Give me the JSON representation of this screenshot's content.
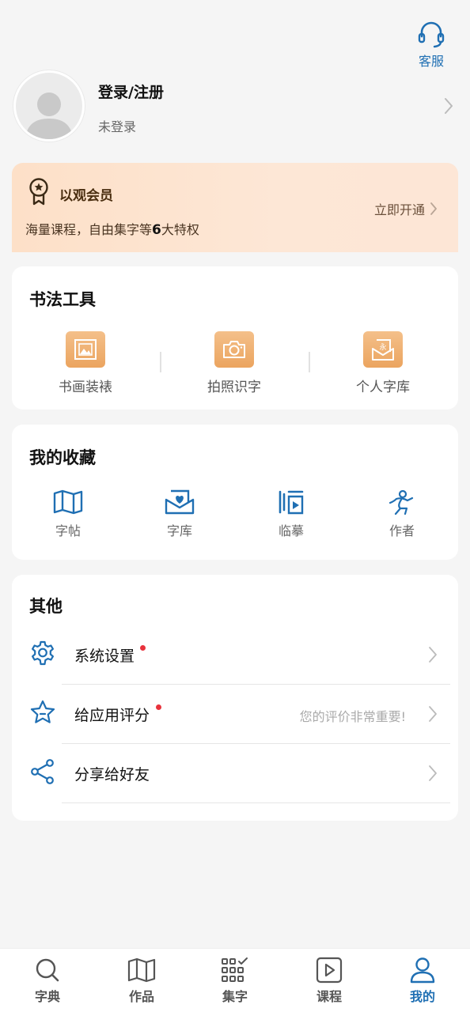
{
  "header": {
    "service_label": "客服"
  },
  "profile": {
    "title": "登录/注册",
    "subtitle": "未登录"
  },
  "vip": {
    "title": "以观会员",
    "desc_prefix": "海量课程，自由集字等",
    "desc_number": "6",
    "desc_suffix": "大特权",
    "cta": "立即开通"
  },
  "tools": {
    "title": "书法工具",
    "items": [
      {
        "label": "书画装裱",
        "icon": "frame-icon"
      },
      {
        "label": "拍照识字",
        "icon": "camera-icon"
      },
      {
        "label": "个人字库",
        "icon": "library-icon"
      }
    ]
  },
  "favorites": {
    "title": "我的收藏",
    "items": [
      {
        "label": "字帖",
        "icon": "map-book-icon"
      },
      {
        "label": "字库",
        "icon": "heart-envelope-icon"
      },
      {
        "label": "临摹",
        "icon": "copy-practice-icon"
      },
      {
        "label": "作者",
        "icon": "author-icon"
      }
    ]
  },
  "other": {
    "title": "其他",
    "items": [
      {
        "label": "系统设置",
        "icon": "gear-icon",
        "hint": "",
        "dot": true
      },
      {
        "label": "给应用评分",
        "icon": "star-icon",
        "hint": "您的评价非常重要!",
        "dot": true
      },
      {
        "label": "分享给好友",
        "icon": "share-icon",
        "hint": "",
        "dot": false
      }
    ]
  },
  "tabbar": {
    "items": [
      {
        "label": "字典",
        "icon": "search-icon",
        "active": false
      },
      {
        "label": "作品",
        "icon": "book-icon",
        "active": false
      },
      {
        "label": "集字",
        "icon": "grid-check-icon",
        "active": false
      },
      {
        "label": "课程",
        "icon": "play-icon",
        "active": false
      },
      {
        "label": "我的",
        "icon": "user-icon",
        "active": true
      }
    ]
  },
  "colors": {
    "accent": "#1f6fb3",
    "vip_bg": "#fde0c8",
    "tool_icon": "#eba45f",
    "dot": "#e8323c"
  }
}
